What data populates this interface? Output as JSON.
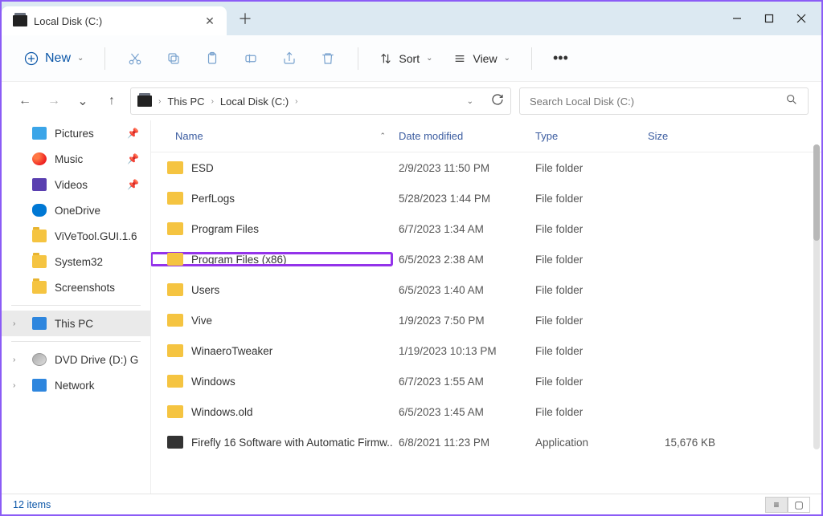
{
  "tab": {
    "title": "Local Disk (C:)"
  },
  "toolbar": {
    "new_label": "New",
    "sort_label": "Sort",
    "view_label": "View"
  },
  "breadcrumbs": [
    "This PC",
    "Local Disk (C:)"
  ],
  "search": {
    "placeholder": "Search Local Disk (C:)"
  },
  "sidebar": {
    "pinned": [
      {
        "label": "Pictures",
        "icon": "pictures"
      },
      {
        "label": "Music",
        "icon": "music"
      },
      {
        "label": "Videos",
        "icon": "videos"
      },
      {
        "label": "OneDrive",
        "icon": "onedrive"
      }
    ],
    "folders": [
      {
        "label": "ViVeTool.GUI.1.6"
      },
      {
        "label": "System32"
      },
      {
        "label": "Screenshots"
      }
    ],
    "system": [
      {
        "label": "This PC",
        "selected": true
      },
      {
        "label": "DVD Drive (D:) G"
      },
      {
        "label": "Network"
      }
    ]
  },
  "columns": {
    "name": "Name",
    "date": "Date modified",
    "type": "Type",
    "size": "Size"
  },
  "items": [
    {
      "name": "ESD",
      "date": "2/9/2023 11:50 PM",
      "type": "File folder",
      "size": "",
      "icon": "folder"
    },
    {
      "name": "PerfLogs",
      "date": "5/28/2023 1:44 PM",
      "type": "File folder",
      "size": "",
      "icon": "folder"
    },
    {
      "name": "Program Files",
      "date": "6/7/2023 1:34 AM",
      "type": "File folder",
      "size": "",
      "icon": "folder"
    },
    {
      "name": "Program Files (x86)",
      "date": "6/5/2023 2:38 AM",
      "type": "File folder",
      "size": "",
      "icon": "folder",
      "highlighted": true
    },
    {
      "name": "Users",
      "date": "6/5/2023 1:40 AM",
      "type": "File folder",
      "size": "",
      "icon": "folder"
    },
    {
      "name": "Vive",
      "date": "1/9/2023 7:50 PM",
      "type": "File folder",
      "size": "",
      "icon": "folder"
    },
    {
      "name": "WinaeroTweaker",
      "date": "1/19/2023 10:13 PM",
      "type": "File folder",
      "size": "",
      "icon": "folder"
    },
    {
      "name": "Windows",
      "date": "6/7/2023 1:55 AM",
      "type": "File folder",
      "size": "",
      "icon": "folder"
    },
    {
      "name": "Windows.old",
      "date": "6/5/2023 1:45 AM",
      "type": "File folder",
      "size": "",
      "icon": "folder"
    },
    {
      "name": "Firefly 16 Software with Automatic Firmw...",
      "date": "6/8/2021 11:23 PM",
      "type": "Application",
      "size": "15,676 KB",
      "icon": "app"
    }
  ],
  "status": {
    "count_label": "12 items"
  }
}
